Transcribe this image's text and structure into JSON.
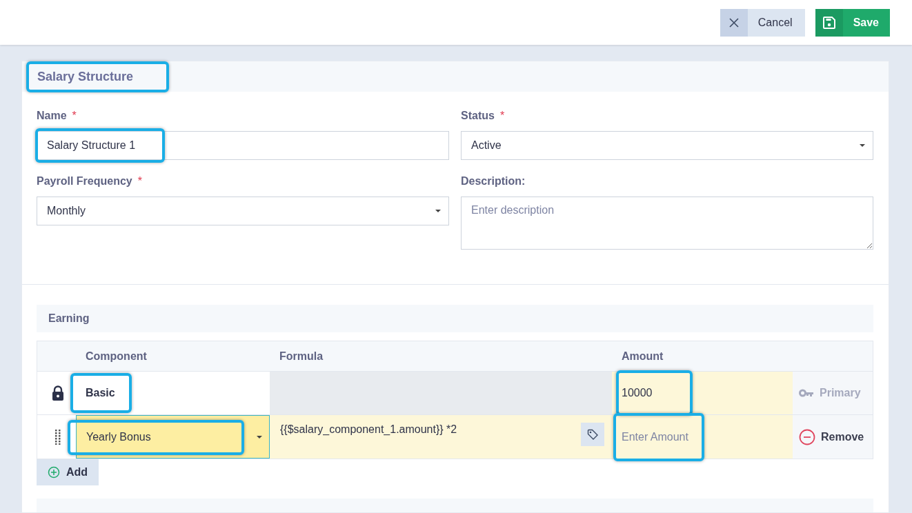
{
  "toolbar": {
    "buttons": [
      {
        "kind": "cancel",
        "label": "Cancel"
      },
      {
        "kind": "save",
        "label": "Save"
      }
    ]
  },
  "form": {
    "title": "Salary Structure",
    "title_highlighted": true,
    "fields": [
      {
        "kind": "text",
        "label": "Name",
        "required_mark": "*",
        "value": "Salary Structure 1",
        "highlighted": true
      },
      {
        "kind": "select",
        "label": "Status",
        "required_mark": "*",
        "value": "Active",
        "highlighted": false
      },
      {
        "kind": "select",
        "label": "Payroll Frequency",
        "required_mark": "*",
        "value": "Monthly",
        "highlighted": false
      },
      {
        "kind": "textarea",
        "label": "Description:",
        "placeholder": "Enter description",
        "highlighted": false
      }
    ]
  },
  "earning": {
    "title": "Earning",
    "columns": [
      "Component",
      "Formula",
      "Amount"
    ],
    "rows": [
      {
        "kind": "locked",
        "component": "Basic",
        "component_highlighted": true,
        "amount": "10000",
        "amount_highlighted": true,
        "action": "Primary"
      },
      {
        "kind": "editable",
        "component": "Yearly Bonus",
        "component_highlighted": true,
        "formula": "{{$salary_component_1.amount}} *2",
        "amount_placeholder": "Enter Amount",
        "amount_highlighted": true,
        "action": "Remove"
      }
    ],
    "add_label": "Add"
  }
}
